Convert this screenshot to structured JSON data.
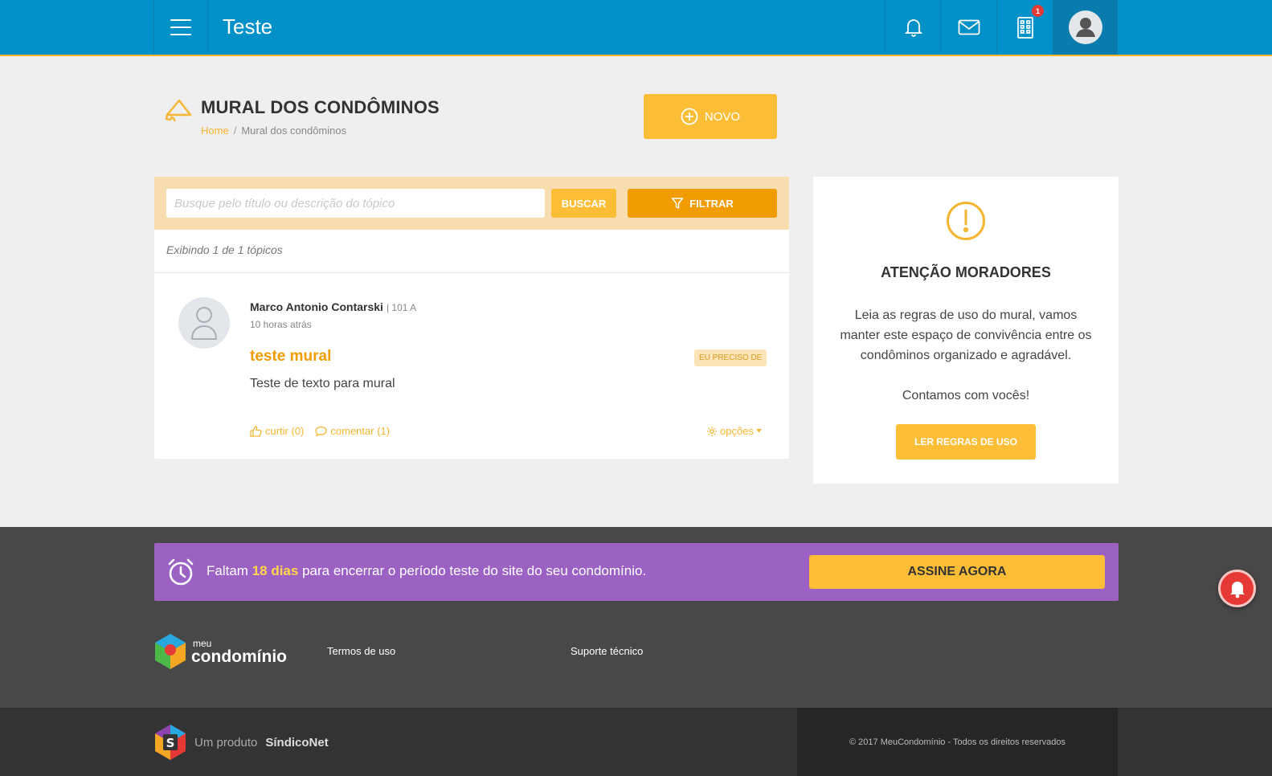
{
  "header": {
    "title": "Teste",
    "icons": [
      "menu-icon",
      "bell-icon",
      "mail-icon",
      "building-icon",
      "user-icon"
    ],
    "building_badge": "1"
  },
  "page": {
    "title": "MURAL DOS CONDÔMINOS",
    "breadcrumb": {
      "home": "Home",
      "separator": "/",
      "current": "Mural dos condôminos"
    },
    "new_button": "NOVO"
  },
  "search": {
    "placeholder": "Busque pelo título ou descrição do tópico",
    "value": "",
    "search_button": "BUSCAR",
    "filter_button": "FILTRAR"
  },
  "results": {
    "count_text": "Exibindo 1 de 1 tópicos"
  },
  "post": {
    "author": "Marco Antonio Contarski",
    "unit": "| 101  A",
    "time": "10 horas atrás",
    "title": "teste mural",
    "tag": "EU PRECISO DE",
    "body": "Teste de texto para mural",
    "like": "curtir (0)",
    "comment": "comentar (1)",
    "options": "opções"
  },
  "notice": {
    "title": "ATENÇÃO MORADORES",
    "text": "Leia as regras de uso do mural, vamos manter este espaço de convivência entre os condôminos organizado e agradável.",
    "text2": "Contamos com vocês!",
    "button": "LER REGRAS DE USO"
  },
  "trial": {
    "before": "Faltam ",
    "days": "18 dias",
    "after": " para encerrar o período teste do site do seu condomínio.",
    "button": "ASSINE AGORA"
  },
  "footer": {
    "logo_small": "meu",
    "logo_big": "condomínio",
    "terms": "Termos de uso",
    "support": "Suporte técnico",
    "product_prefix": "Um produto ",
    "product_name": "SíndicoNet",
    "copyright": "© 2017 MeuCondomínio - Todos os direitos reservados"
  },
  "colors": {
    "header": "#0190c8",
    "accent": "#fcbe37",
    "filter": "#f19c00",
    "trial": "#9b62c4",
    "alert": "#e53935"
  }
}
